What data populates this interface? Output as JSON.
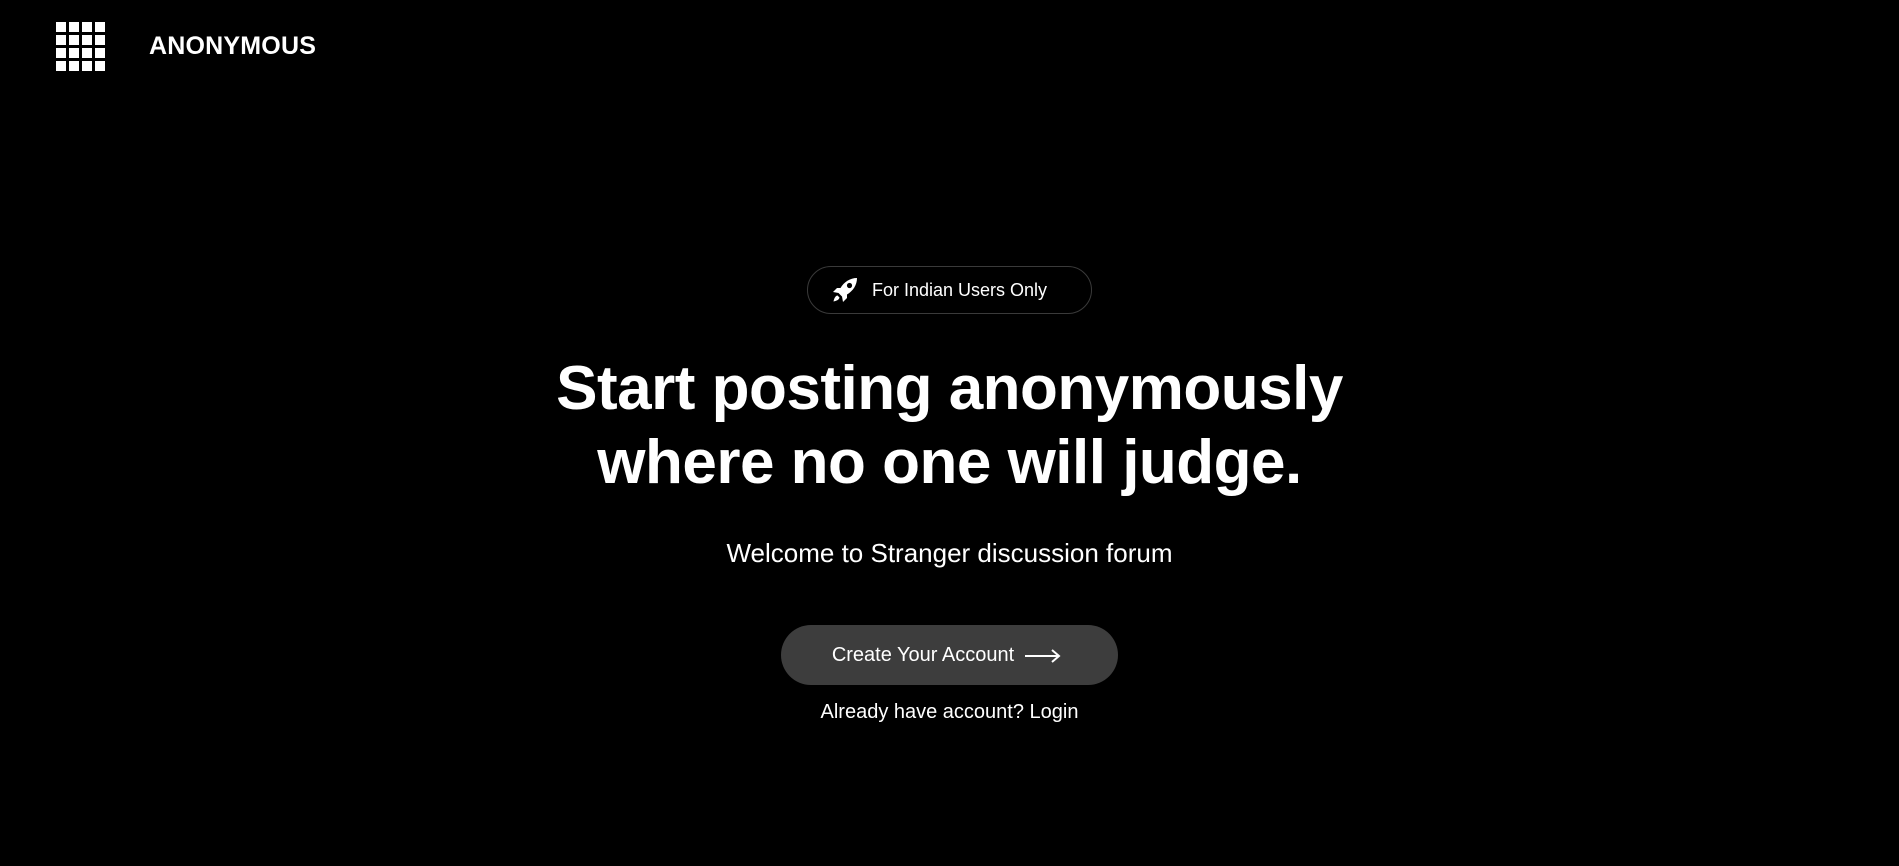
{
  "header": {
    "logo_icon": "grid-logo-icon",
    "brand": "ANONYMOUS"
  },
  "hero": {
    "badge": {
      "icon": "rocket-icon",
      "text": "For Indian Users Only"
    },
    "headline_line1": "Start posting anonymously",
    "headline_line2": "where no one will judge.",
    "subtitle": "Welcome to Stranger discussion forum",
    "cta_label": "Create Your Account",
    "cta_icon": "arrow-right-icon",
    "login_text": "Already have account? Login"
  },
  "colors": {
    "background": "#000000",
    "text": "#ffffff",
    "button": "#3d3d3d",
    "pill_border": "#3a3a3a"
  }
}
